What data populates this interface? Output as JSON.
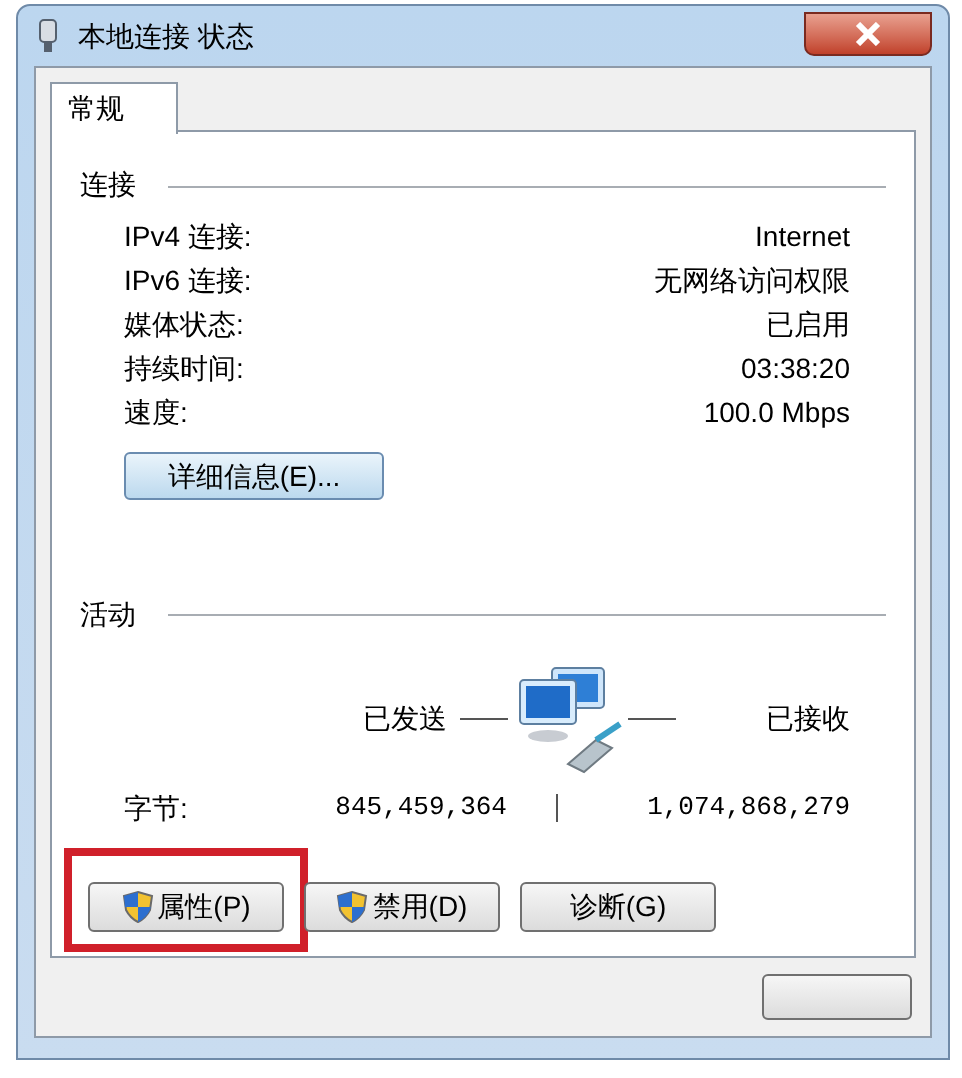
{
  "window": {
    "title": "本地连接 状态"
  },
  "tabs": [
    {
      "label": "常规",
      "selected": true
    }
  ],
  "connection": {
    "heading": "连接",
    "rows": [
      {
        "label": "IPv4 连接:",
        "value": "Internet"
      },
      {
        "label": "IPv6 连接:",
        "value": "无网络访问权限"
      },
      {
        "label": "媒体状态:",
        "value": "已启用"
      },
      {
        "label": "持续时间:",
        "value": "03:38:20"
      },
      {
        "label": "速度:",
        "value": "100.0 Mbps"
      }
    ],
    "details_button": "详细信息(E)..."
  },
  "activity": {
    "heading": "活动",
    "sent_label": "已发送",
    "received_label": "已接收",
    "bytes_label": "字节:",
    "sent": "845,459,364",
    "received": "1,074,868,279"
  },
  "buttons": [
    {
      "label": "属性(P)",
      "shield": true,
      "highlighted": true
    },
    {
      "label": "禁用(D)",
      "shield": true,
      "highlighted": false
    },
    {
      "label": "诊断(G)",
      "shield": false,
      "highlighted": false
    }
  ]
}
